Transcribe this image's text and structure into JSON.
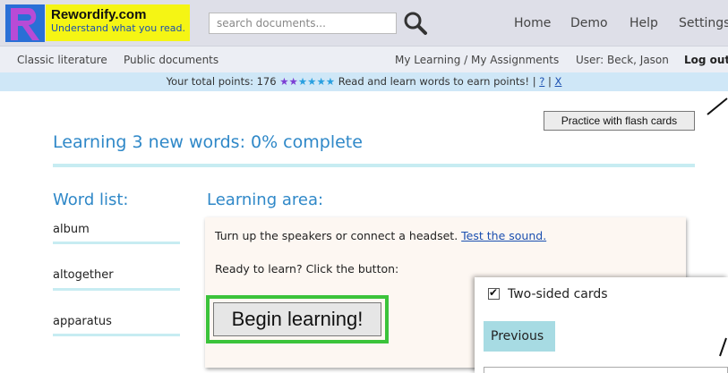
{
  "header": {
    "brand_name": "Rewordify.com",
    "brand_tagline": "Understand what you read.",
    "search_placeholder": "search documents...",
    "nav": [
      "Home",
      "Demo",
      "Help",
      "Settings"
    ]
  },
  "subnav": {
    "left": [
      "Classic literature",
      "Public documents"
    ],
    "my_learning": "My Learning / My Assignments",
    "user": "User: Beck, Jason",
    "logout": "Log out"
  },
  "points_bar": {
    "prefix": "Your total points: 176",
    "stars_purple": "★★",
    "stars_blue": "★★★★",
    "message": "Read and learn words to earn points!",
    "sep1": "|",
    "help_link": "?",
    "sep2": "|",
    "close_link": "X"
  },
  "flash_cards_button": "Practice with flash cards",
  "page_title": "Learning 3 new words: 0% complete",
  "word_list": {
    "heading": "Word list:",
    "words": [
      "album",
      "altogether",
      "apparatus"
    ]
  },
  "learning_area": {
    "heading": "Learning area:",
    "speaker_text": "Turn up the speakers or connect a headset.",
    "test_sound_link": "Test the sound.",
    "ready_text": "Ready to learn? Click the button:",
    "begin_button": "Begin learning!"
  },
  "overlay": {
    "two_sided_label": "Two-sided cards",
    "previous_button": "Previous"
  },
  "colors": {
    "accent_blue": "#2f88c8",
    "brand_yellow": "#f5f514",
    "highlight_green": "#3bc33b",
    "rule_cyan": "#c7ecf2"
  }
}
